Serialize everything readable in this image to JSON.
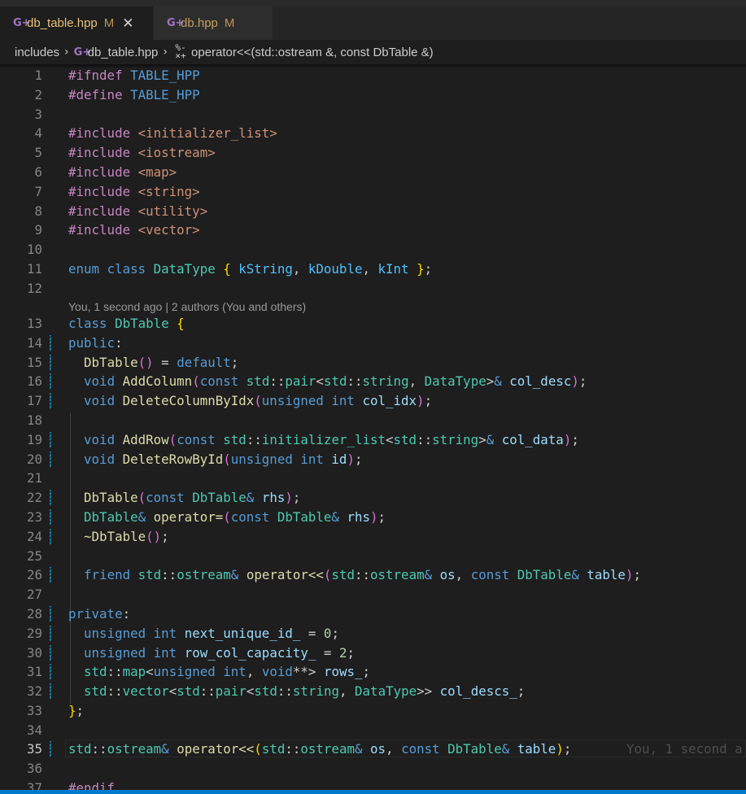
{
  "tabs": [
    {
      "label": "db_table.hpp",
      "badge": "M",
      "icon": "cpp-file-icon",
      "active": true
    },
    {
      "label": "db.hpp",
      "badge": "M",
      "icon": "cpp-file-icon",
      "active": false
    }
  ],
  "breadcrumb": {
    "folder": "includes",
    "file": "db_table.hpp",
    "symbol": "operator<<(std::ostream &, const DbTable &)"
  },
  "codelens": "You, 1 second ago | 2 authors (You and others)",
  "inline_blame": "You, 1 second a",
  "current_line": "35",
  "colors": {
    "accent": "#007acc",
    "background": "#1e1e1e",
    "git_modified": "#1b81a8"
  }
}
